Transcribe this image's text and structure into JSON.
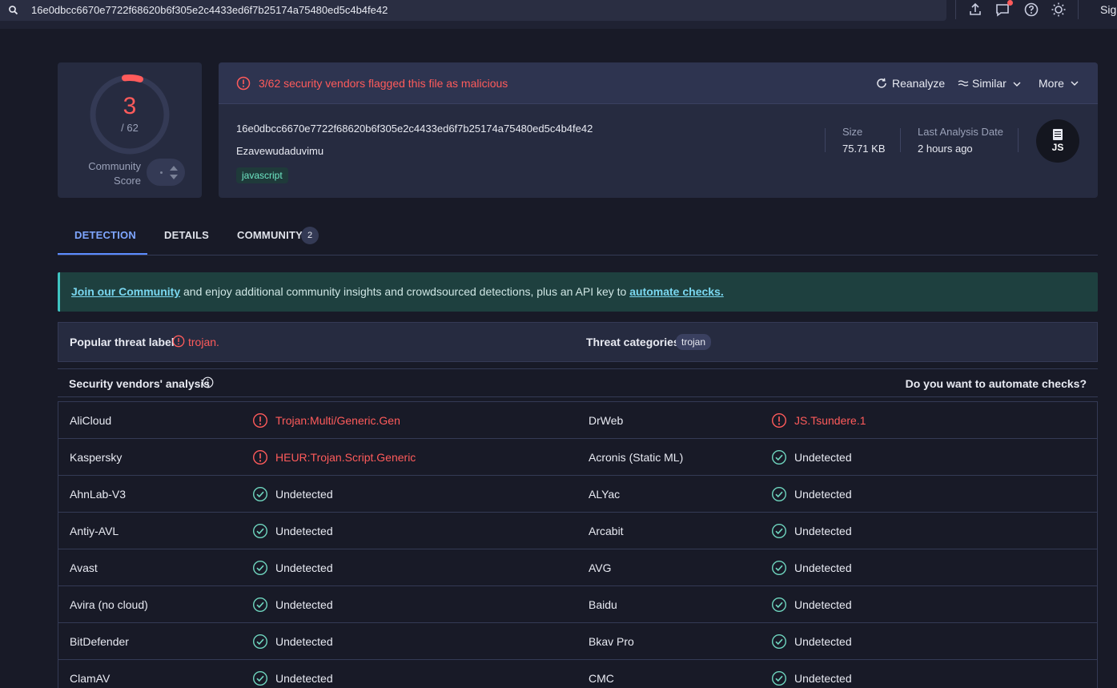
{
  "topbar": {
    "search_value": "16e0dbcc6670e7722f68620b6f305e2c4433ed6f7b25174a75480ed5c4b4fe42",
    "sign_in_label": "Sig",
    "icons": [
      "upload-icon",
      "chat-icon",
      "help-icon",
      "theme-icon"
    ]
  },
  "score": {
    "detections": "3",
    "total": "/ 62",
    "community_label_1": "Community",
    "community_label_2": "Score"
  },
  "summary": {
    "flag_text": "3/62 security vendors flagged this file as malicious",
    "reanalyze_label": "Reanalyze",
    "similar_label": "Similar",
    "more_label": "More",
    "hash": "16e0dbcc6670e7722f68620b6f305e2c4433ed6f7b25174a75480ed5c4b4fe42",
    "filename": "Ezavewudaduvimu",
    "tag": "javascript",
    "size_label": "Size",
    "size_value": "75.71 KB",
    "last_analysis_label": "Last Analysis Date",
    "last_analysis_value": "2 hours ago",
    "file_type_label": "JS"
  },
  "tabs": {
    "detection": "DETECTION",
    "details": "DETAILS",
    "community": "COMMUNITY",
    "community_count": "2"
  },
  "banner": {
    "link1": "Join our Community",
    "middle": " and enjoy additional community insights and crowdsourced detections, plus an API key to ",
    "link2": "automate checks."
  },
  "threat": {
    "popular_label": "Popular threat label",
    "popular_value": "trojan.",
    "categories_label": "Threat categories",
    "category_chip": "trojan"
  },
  "vendors_header": {
    "title": "Security vendors' analysis",
    "automate_question": "Do you want to automate checks?"
  },
  "colors": {
    "malicious": "#ff5b5b",
    "undetected": "#6fd6bf",
    "accent": "#5c8cff"
  },
  "vendors": [
    {
      "left_name": "AliCloud",
      "left_result": "Trojan:Multi/Generic.Gen",
      "left_status": "malicious",
      "right_name": "DrWeb",
      "right_result": "JS.Tsundere.1",
      "right_status": "malicious"
    },
    {
      "left_name": "Kaspersky",
      "left_result": "HEUR:Trojan.Script.Generic",
      "left_status": "malicious",
      "right_name": "Acronis (Static ML)",
      "right_result": "Undetected",
      "right_status": "undetected"
    },
    {
      "left_name": "AhnLab-V3",
      "left_result": "Undetected",
      "left_status": "undetected",
      "right_name": "ALYac",
      "right_result": "Undetected",
      "right_status": "undetected"
    },
    {
      "left_name": "Antiy-AVL",
      "left_result": "Undetected",
      "left_status": "undetected",
      "right_name": "Arcabit",
      "right_result": "Undetected",
      "right_status": "undetected"
    },
    {
      "left_name": "Avast",
      "left_result": "Undetected",
      "left_status": "undetected",
      "right_name": "AVG",
      "right_result": "Undetected",
      "right_status": "undetected"
    },
    {
      "left_name": "Avira (no cloud)",
      "left_result": "Undetected",
      "left_status": "undetected",
      "right_name": "Baidu",
      "right_result": "Undetected",
      "right_status": "undetected"
    },
    {
      "left_name": "BitDefender",
      "left_result": "Undetected",
      "left_status": "undetected",
      "right_name": "Bkav Pro",
      "right_result": "Undetected",
      "right_status": "undetected"
    },
    {
      "left_name": "ClamAV",
      "left_result": "Undetected",
      "left_status": "undetected",
      "right_name": "CMC",
      "right_result": "Undetected",
      "right_status": "undetected"
    }
  ]
}
